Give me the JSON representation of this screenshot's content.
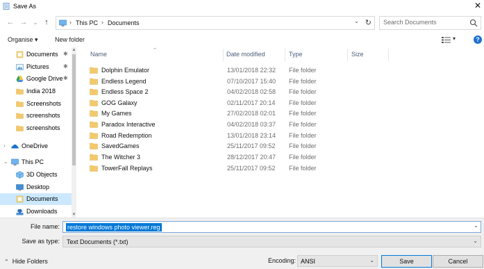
{
  "window": {
    "title": "Save As",
    "close_glyph": "✕"
  },
  "nav": {
    "back_glyph": "←",
    "forward_glyph": "→",
    "recent_glyph": "⌄",
    "up_glyph": "↑",
    "breadcrumb": [
      "This PC",
      "Documents"
    ],
    "breadcrumb_sep": "›",
    "search_placeholder": "Search Documents"
  },
  "toolbar": {
    "organise_label": "Organise ▾",
    "new_folder_label": "New folder",
    "help_label": "?"
  },
  "sidebar": {
    "items": [
      {
        "label": "Documents",
        "icon": "documents-icon",
        "pinned": true
      },
      {
        "label": "Pictures",
        "icon": "pictures-icon",
        "pinned": true
      },
      {
        "label": "Google Drive",
        "icon": "google-drive-icon",
        "pinned": true
      },
      {
        "label": "India 2018",
        "icon": "folder-icon",
        "pinned": false
      },
      {
        "label": "Screenshots",
        "icon": "folder-icon",
        "pinned": false
      },
      {
        "label": "screenshots",
        "icon": "folder-icon",
        "pinned": false
      },
      {
        "label": "screenshots",
        "icon": "folder-icon",
        "pinned": false
      },
      {
        "label": "OneDrive",
        "icon": "onedrive-icon",
        "pinned": false
      },
      {
        "label": "This PC",
        "icon": "this-pc-icon",
        "pinned": false
      },
      {
        "label": "3D Objects",
        "icon": "3d-objects-icon",
        "pinned": false
      },
      {
        "label": "Desktop",
        "icon": "desktop-icon",
        "pinned": false
      },
      {
        "label": "Documents",
        "icon": "documents-icon",
        "pinned": false,
        "selected": true
      },
      {
        "label": "Downloads",
        "icon": "downloads-icon",
        "pinned": false
      }
    ],
    "pin_glyph": "✱"
  },
  "file_list": {
    "columns": {
      "name": "Name",
      "date": "Date modified",
      "type": "Type",
      "size": "Size"
    },
    "rows": [
      {
        "name": "Dolphin Emulator",
        "date": "13/01/2018 22:32",
        "type": "File folder"
      },
      {
        "name": "Endless Legend",
        "date": "07/10/2017 15:40",
        "type": "File folder"
      },
      {
        "name": "Endless Space 2",
        "date": "04/02/2018 02:58",
        "type": "File folder"
      },
      {
        "name": "GOG Galaxy",
        "date": "02/11/2017 20:14",
        "type": "File folder"
      },
      {
        "name": "My Games",
        "date": "27/02/2018 02:01",
        "type": "File folder"
      },
      {
        "name": "Paradox Interactive",
        "date": "04/02/2018 03:37",
        "type": "File folder"
      },
      {
        "name": "Road Redemption",
        "date": "13/01/2018 23:14",
        "type": "File folder"
      },
      {
        "name": "SavedGames",
        "date": "25/11/2017 09:52",
        "type": "File folder"
      },
      {
        "name": "The Witcher 3",
        "date": "28/12/2017 20:47",
        "type": "File folder"
      },
      {
        "name": "TowerFall Replays",
        "date": "25/11/2017 09:52",
        "type": "File folder"
      }
    ]
  },
  "form": {
    "file_name_label": "File name:",
    "file_name_value": "restore windows photo viewer.reg",
    "save_as_type_label": "Save as type:",
    "save_as_type_value": "Text Documents (*.txt)",
    "hide_folders_label": "Hide Folders",
    "encoding_label": "Encoding:",
    "encoding_value": "ANSI",
    "save_label": "Save",
    "cancel_label": "Cancel"
  },
  "colors": {
    "selection": "#cce8ff",
    "folder": "#f3c96b",
    "accent": "#0078d7"
  }
}
